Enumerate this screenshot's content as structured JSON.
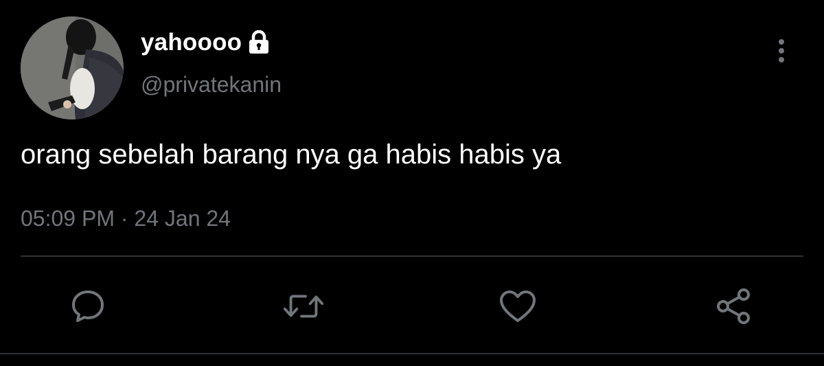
{
  "author": {
    "display_name": "yahoooo",
    "handle": "@privatekanin",
    "protected_icon": "lock-icon"
  },
  "tweet": {
    "text": "orang sebelah barang nya ga habis habis ya",
    "time": "05:09 PM",
    "separator": "·",
    "date": "24 Jan 24"
  },
  "actions": {
    "reply_icon": "reply-icon",
    "retweet_icon": "retweet-icon",
    "like_icon": "heart-icon",
    "share_icon": "share-icon",
    "more_icon": "more-vertical-icon"
  },
  "colors": {
    "background": "#000000",
    "text": "#ffffff",
    "secondary_text": "#71767b",
    "divider": "#2f3336"
  }
}
